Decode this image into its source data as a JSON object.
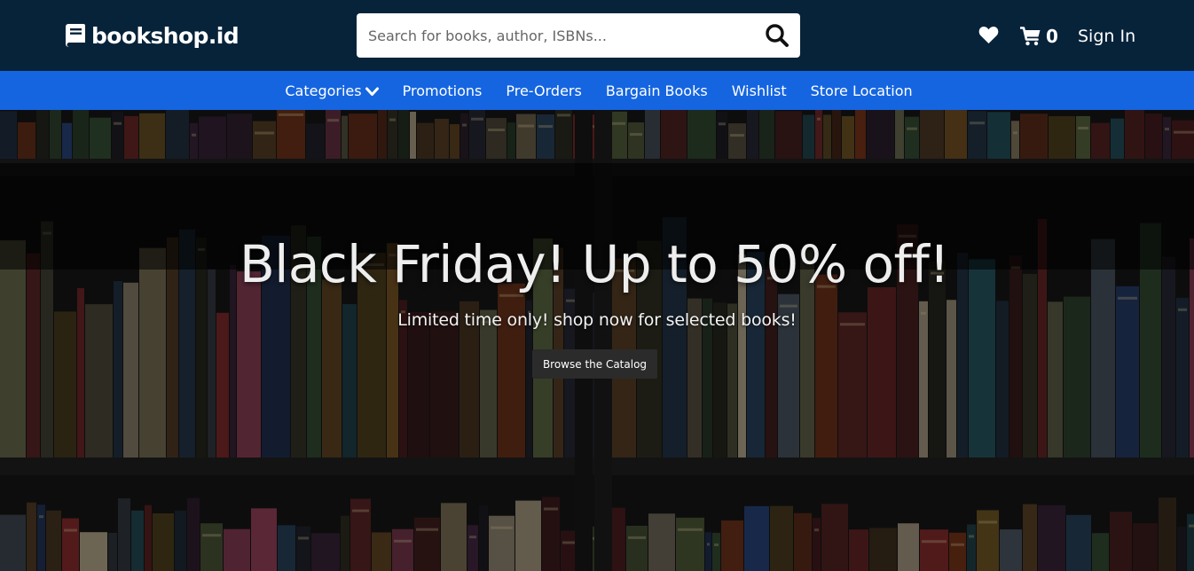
{
  "header": {
    "logo_text": "bookshop.id",
    "search_placeholder": "Search for books, author, ISBNs...",
    "cart_count": "0",
    "signin_label": "Sign In"
  },
  "nav": {
    "items": [
      {
        "label": "Categories"
      },
      {
        "label": "Promotions"
      },
      {
        "label": "Pre-Orders"
      },
      {
        "label": "Bargain Books"
      },
      {
        "label": "Wishlist"
      },
      {
        "label": "Store Location"
      }
    ]
  },
  "hero": {
    "title": "Black Friday! Up to 50% off!",
    "subtitle": "Limited time only! shop now for selected books!",
    "cta_label": "Browse the Catalog"
  },
  "colors": {
    "header_bg": "#07233a",
    "nav_bg": "#1565e1",
    "cta_bg": "#2b2b2b"
  },
  "icons": {
    "logo": "book-icon",
    "search": "search-icon",
    "wishlist": "heart-icon",
    "cart": "cart-icon",
    "categories": "chevron-down-icon"
  }
}
